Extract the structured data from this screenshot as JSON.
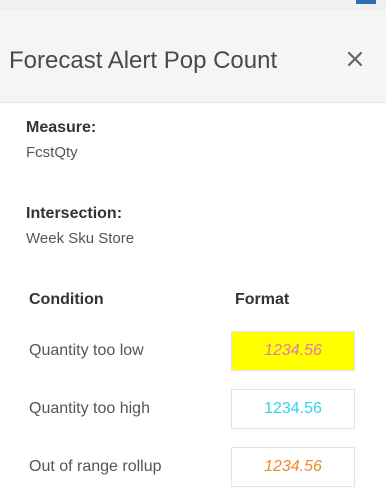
{
  "dialog": {
    "title": "Forecast Alert Pop Count"
  },
  "measure": {
    "label": "Measure:",
    "value": "FcstQty"
  },
  "intersection": {
    "label": "Intersection:",
    "value": "Week Sku Store"
  },
  "table": {
    "headers": [
      "Condition",
      "Format"
    ],
    "rows": [
      {
        "condition": "Quantity too low",
        "format": "1234.56",
        "bg": "#ffff00",
        "color": "#e07ab8",
        "italic": true
      },
      {
        "condition": "Quantity too high",
        "format": "1234.56",
        "bg": "#ffffff",
        "color": "#33d3e8",
        "italic": false
      },
      {
        "condition": "Out of range rollup",
        "format": "1234.56",
        "bg": "#ffffff",
        "color": "#f08a24",
        "italic": true
      }
    ]
  },
  "icons": {
    "close": "close-icon"
  }
}
